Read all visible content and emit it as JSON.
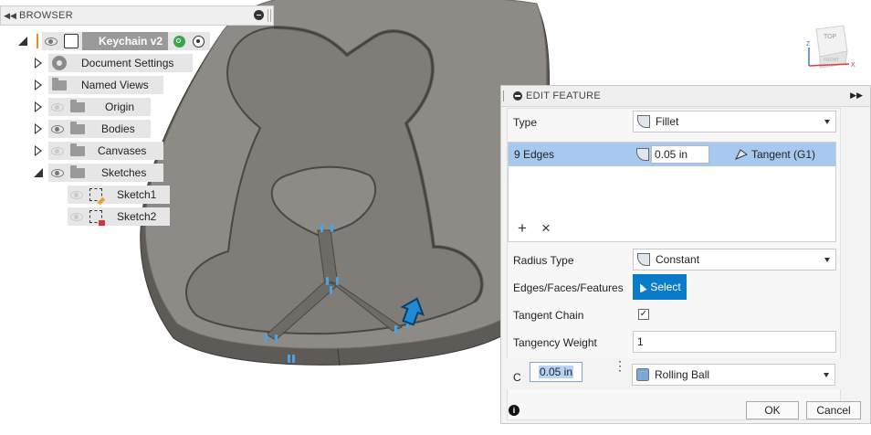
{
  "browser": {
    "title": "BROWSER",
    "items": [
      {
        "label": "Keychain v2",
        "kind": "document"
      },
      {
        "label": "Document Settings",
        "kind": "settings"
      },
      {
        "label": "Named Views",
        "kind": "folder"
      },
      {
        "label": "Origin",
        "kind": "folder"
      },
      {
        "label": "Bodies",
        "kind": "folder"
      },
      {
        "label": "Canvases",
        "kind": "folder"
      },
      {
        "label": "Sketches",
        "kind": "folder"
      },
      {
        "label": "Sketch1",
        "kind": "sketch"
      },
      {
        "label": "Sketch2",
        "kind": "sketch"
      }
    ]
  },
  "viewcube": {
    "face_top": "TOP",
    "face_front": "FRONT",
    "axis_x": "X",
    "axis_z": "Z"
  },
  "edit_feature": {
    "title": "EDIT FEATURE",
    "type_label": "Type",
    "type_value": "Fillet",
    "edges_label": "9 Edges",
    "edges_radius": "0.05 in",
    "edges_continuity": "Tangent (G1)",
    "add_symbol": "+",
    "remove_symbol": "×",
    "radius_type_label": "Radius Type",
    "radius_type_value": "Constant",
    "edges_faces_label": "Edges/Faces/Features",
    "select_label": "Select",
    "tangent_chain_label": "Tangent Chain",
    "tangent_chain_checked": true,
    "tangency_weight_label": "Tangency Weight",
    "tangency_weight_value": "1",
    "corner_label": "C",
    "corner_radius": "0.05 in",
    "corner_type_value": "Rolling Ball",
    "ok_label": "OK",
    "cancel_label": "Cancel",
    "info_icon": "i"
  },
  "colors": {
    "accent": "#0a7bc8",
    "selection": "#a8c9ef",
    "model_face": "#8e8b86",
    "model_side": "#5e5b56"
  }
}
